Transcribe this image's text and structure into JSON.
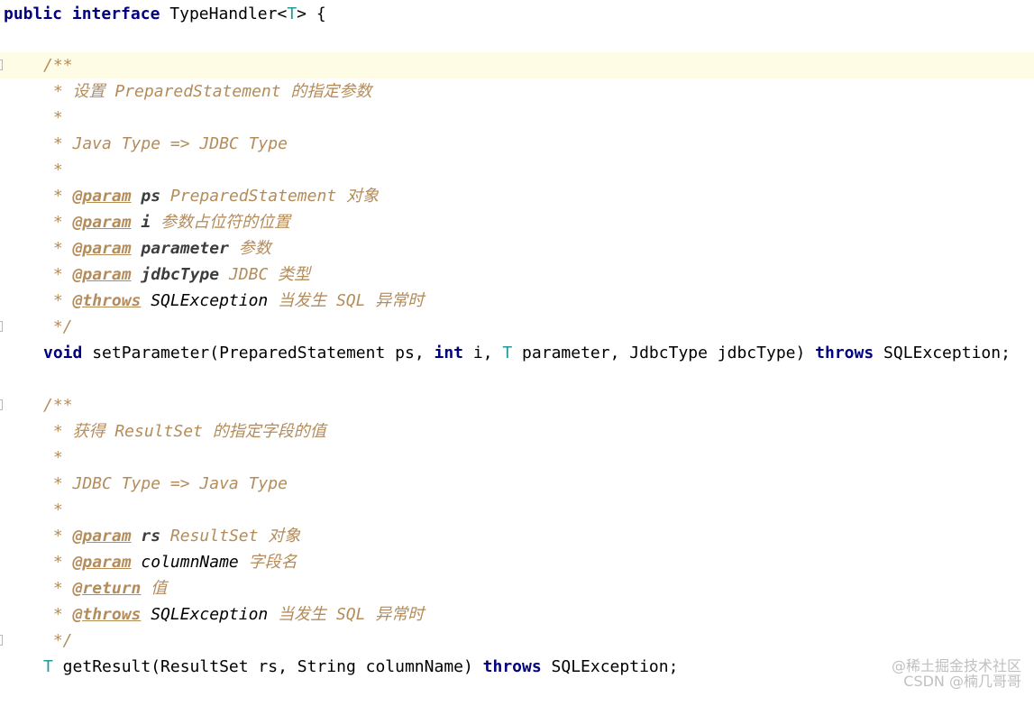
{
  "header": {
    "public": "public",
    "interface": "interface",
    "name": "TypeHandler<",
    "t": "T",
    "close": "> {"
  },
  "doc1": {
    "open": "/**",
    "desc": " * 设置 PreparedStatement 的指定参数",
    "star": " *",
    "map": " * Java Type => JDBC Type",
    "params": [
      {
        "prefix": " * ",
        "tag": "@param",
        "name": "ps",
        "desc": "PreparedStatement 对象"
      },
      {
        "prefix": " * ",
        "tag": "@param",
        "name": "i",
        "desc": "参数占位符的位置"
      },
      {
        "prefix": " * ",
        "tag": "@param",
        "name": "parameter",
        "desc": "参数"
      },
      {
        "prefix": " * ",
        "tag": "@param",
        "name": "jdbcType",
        "desc": "JDBC 类型"
      }
    ],
    "throws": {
      "prefix": " * ",
      "tag": "@throws",
      "name": "SQLException",
      "desc": "当发生 SQL 异常时"
    },
    "close": " */"
  },
  "method1": {
    "void": "void",
    "sig_a": " setParameter(PreparedStatement ps, ",
    "int": "int",
    "sig_b": " i, ",
    "t": "T",
    "sig_c": " parameter, JdbcType jdbcType) ",
    "throws": "throws",
    "sig_d": " SQLException;"
  },
  "doc2": {
    "open": "/**",
    "desc": " * 获得 ResultSet 的指定字段的值",
    "star": " *",
    "map": " * JDBC Type => Java Type",
    "params": [
      {
        "prefix": " * ",
        "tag": "@param",
        "name": "rs",
        "desc": "ResultSet 对象"
      },
      {
        "prefix": " * ",
        "tag": "@param",
        "name": "columnName",
        "desc": "字段名"
      }
    ],
    "return": {
      "prefix": " * ",
      "tag": "@return",
      "desc": "值"
    },
    "throws": {
      "prefix": " * ",
      "tag": "@throws",
      "name": "SQLException",
      "desc": "当发生 SQL 异常时"
    },
    "close": " */"
  },
  "method2": {
    "t": "T",
    "sig_a": " getResult(ResultSet rs, String columnName) ",
    "throws": "throws",
    "sig_b": " SQLException;"
  },
  "watermark": {
    "line1": "@稀土掘金技术社区",
    "line2": "CSDN @楠几哥哥"
  },
  "colors": {
    "keyword": "#000080",
    "type_param": "#20999d",
    "comment": "#b48c5a",
    "current_line": "#fefce4"
  }
}
